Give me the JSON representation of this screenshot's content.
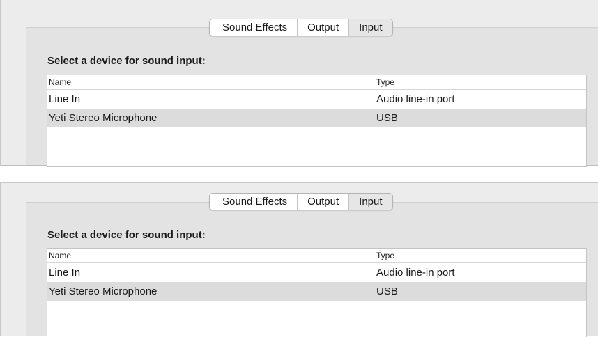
{
  "panels": [
    {
      "tabs": [
        {
          "label": "Sound Effects"
        },
        {
          "label": "Output"
        },
        {
          "label": "Input"
        }
      ],
      "heading": "Select a device for sound input:",
      "columns": {
        "name": "Name",
        "type": "Type"
      },
      "rows": [
        {
          "name": "Line In",
          "type": "Audio line-in port",
          "selected": false
        },
        {
          "name": "Yeti Stereo Microphone",
          "type": "USB",
          "selected": true
        }
      ]
    },
    {
      "tabs": [
        {
          "label": "Sound Effects"
        },
        {
          "label": "Output"
        },
        {
          "label": "Input"
        }
      ],
      "heading": "Select a device for sound input:",
      "columns": {
        "name": "Name",
        "type": "Type"
      },
      "rows": [
        {
          "name": "Line In",
          "type": "Audio line-in port",
          "selected": false
        },
        {
          "name": "Yeti Stereo Microphone",
          "type": "USB",
          "selected": true
        }
      ]
    }
  ]
}
